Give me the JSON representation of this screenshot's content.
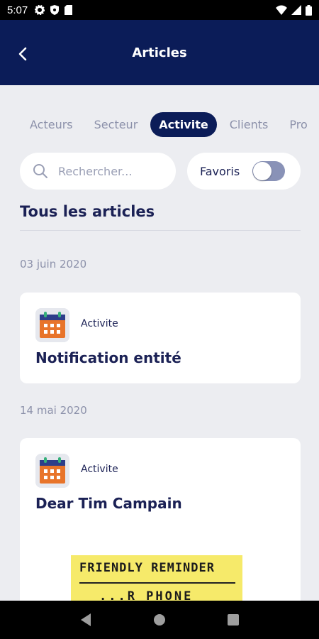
{
  "status_bar": {
    "time": "5:07"
  },
  "header": {
    "title": "Articles"
  },
  "tabs": [
    {
      "label": "Acteurs",
      "active": false
    },
    {
      "label": "Secteur",
      "active": false
    },
    {
      "label": "Activite",
      "active": true
    },
    {
      "label": "Clients",
      "active": false
    },
    {
      "label": "Pro",
      "active": false
    }
  ],
  "search": {
    "placeholder": "Rechercher..."
  },
  "favorites": {
    "label": "Favoris",
    "enabled": false
  },
  "section": {
    "title": "Tous les articles"
  },
  "articles": [
    {
      "date": "03 juin 2020",
      "category": "Activite",
      "title": "Notification entité"
    },
    {
      "date": "14 mai 2020",
      "category": "Activite",
      "title": "Dear Tim Campain",
      "image_text": {
        "line1": "FRIENDLY REMINDER",
        "line2": "...R PHONE"
      }
    }
  ],
  "colors": {
    "primary": "#0b1c58",
    "background": "#ecedf1",
    "calendar_orange": "#e8742a",
    "note_yellow": "#f6ea6a"
  },
  "icons": {
    "back": "back-arrow-icon",
    "search": "search-icon",
    "category": "calendar-icon"
  }
}
